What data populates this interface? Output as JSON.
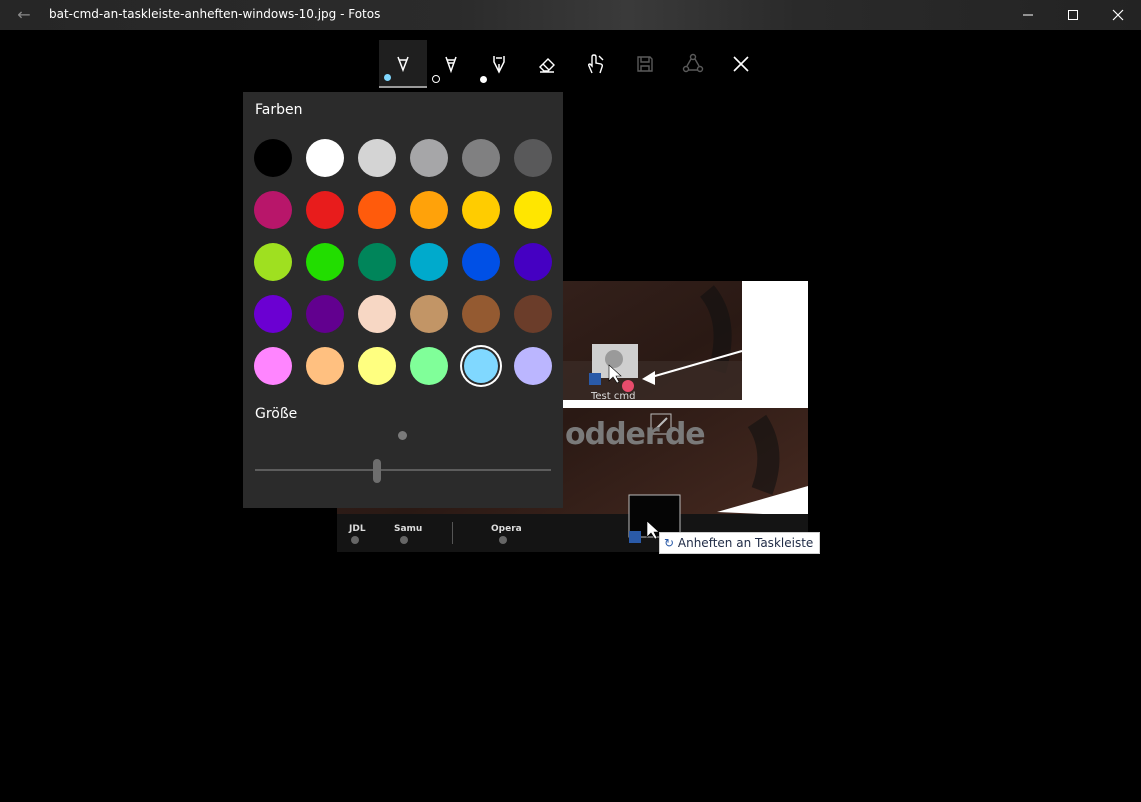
{
  "window": {
    "title": "bat-cmd-an-taskleiste-anheften-windows-10.jpg - Fotos"
  },
  "toolbar": {
    "tools": [
      "ballpoint-pen",
      "pencil",
      "calligraphy-pen",
      "eraser",
      "touch-writing",
      "save",
      "share",
      "close"
    ]
  },
  "panel": {
    "colors_heading": "Farben",
    "size_heading": "Größe",
    "swatches": [
      "#000000",
      "#ffffff",
      "#d4d4d4",
      "#a6a6a8",
      "#808081",
      "#59595a",
      "#b8166a",
      "#e81c1c",
      "#ff5b0c",
      "#ffa20a",
      "#ffcc00",
      "#ffe600",
      "#9fe020",
      "#22dd00",
      "#00855a",
      "#00aacc",
      "#0050e6",
      "#4500c2",
      "#6b00d2",
      "#62008f",
      "#f7d7c4",
      "#c29566",
      "#945a31",
      "#6b3d2a",
      "#ff85ff",
      "#ffc080",
      "#ffff80",
      "#80ff99",
      "#80d8ff",
      "#bbb6ff"
    ],
    "selected_index": 28,
    "size_value": 0.41
  },
  "photo": {
    "file_label": "Test cmd",
    "watermark": "odder.de",
    "taskbar_items": [
      "JDL",
      "Samu",
      "Opera"
    ],
    "tooltip": "Anheften an Taskleiste"
  }
}
